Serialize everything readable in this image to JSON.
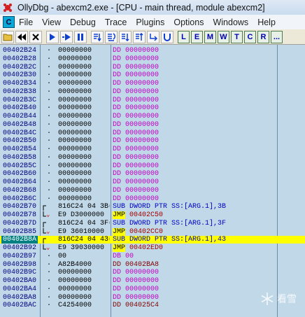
{
  "title": "OllyDbg - abexcm2.exe - [CPU - main thread, module abexcm2]",
  "menu": [
    "File",
    "View",
    "Debug",
    "Trace",
    "Plugins",
    "Options",
    "Windows",
    "Help"
  ],
  "menu_icon": "C",
  "toolbar_letters": [
    "L",
    "E",
    "M",
    "W",
    "T",
    "C",
    "R",
    "..."
  ],
  "watermark": "看雪",
  "rows": [
    {
      "addr": "00402B24",
      "dot": "·",
      "hex": "00000000",
      "mnem": "DD 00000000",
      "kind": "dd"
    },
    {
      "addr": "00402B28",
      "dot": "·",
      "hex": "00000000",
      "mnem": "DD 00000000",
      "kind": "dd"
    },
    {
      "addr": "00402B2C",
      "dot": "·",
      "hex": "00000000",
      "mnem": "DD 00000000",
      "kind": "dd"
    },
    {
      "addr": "00402B30",
      "dot": "·",
      "hex": "00000000",
      "mnem": "DD 00000000",
      "kind": "dd"
    },
    {
      "addr": "00402B34",
      "dot": "·",
      "hex": "00000000",
      "mnem": "DD 00000000",
      "kind": "dd"
    },
    {
      "addr": "00402B38",
      "dot": "·",
      "hex": "00000000",
      "mnem": "DD 00000000",
      "kind": "dd"
    },
    {
      "addr": "00402B3C",
      "dot": "·",
      "hex": "00000000",
      "mnem": "DD 00000000",
      "kind": "dd"
    },
    {
      "addr": "00402B40",
      "dot": "·",
      "hex": "00000000",
      "mnem": "DD 00000000",
      "kind": "dd"
    },
    {
      "addr": "00402B44",
      "dot": "·",
      "hex": "00000000",
      "mnem": "DD 00000000",
      "kind": "dd"
    },
    {
      "addr": "00402B48",
      "dot": "·",
      "hex": "00000000",
      "mnem": "DD 00000000",
      "kind": "dd"
    },
    {
      "addr": "00402B4C",
      "dot": "·",
      "hex": "00000000",
      "mnem": "DD 00000000",
      "kind": "dd"
    },
    {
      "addr": "00402B50",
      "dot": "·",
      "hex": "00000000",
      "mnem": "DD 00000000",
      "kind": "dd"
    },
    {
      "addr": "00402B54",
      "dot": "·",
      "hex": "00000000",
      "mnem": "DD 00000000",
      "kind": "dd"
    },
    {
      "addr": "00402B58",
      "dot": "·",
      "hex": "00000000",
      "mnem": "DD 00000000",
      "kind": "dd"
    },
    {
      "addr": "00402B5C",
      "dot": "·",
      "hex": "00000000",
      "mnem": "DD 00000000",
      "kind": "dd"
    },
    {
      "addr": "00402B60",
      "dot": "·",
      "hex": "00000000",
      "mnem": "DD 00000000",
      "kind": "dd"
    },
    {
      "addr": "00402B64",
      "dot": "·",
      "hex": "00000000",
      "mnem": "DD 00000000",
      "kind": "dd"
    },
    {
      "addr": "00402B68",
      "dot": "·",
      "hex": "00000000",
      "mnem": "DD 00000000",
      "kind": "dd"
    },
    {
      "addr": "00402B6C",
      "dot": "·",
      "hex": "00000000",
      "mnem": "DD 00000000",
      "kind": "dd"
    },
    {
      "addr": "00402B70",
      "dot": "",
      "hex": "816C24 04 3B(",
      "mnem": "SUB DWORD PTR SS:[ARG.1],3B",
      "kind": "sub",
      "mark": "top"
    },
    {
      "addr": "00402B78",
      "dot": "",
      "hex": "E9 D3000000",
      "mnem": "JMP 00402C50",
      "kind": "jmp",
      "mark": "bottom"
    },
    {
      "addr": "00402B7D",
      "dot": "",
      "hex": "816C24 04 3F(",
      "mnem": "SUB DWORD PTR SS:[ARG.1],3F",
      "kind": "sub",
      "mark": "top"
    },
    {
      "addr": "00402B85",
      "dot": "",
      "hex": "E9 36010000",
      "mnem": "JMP 00402CC0",
      "kind": "jmp",
      "mark": "bottom"
    },
    {
      "addr": "00402B8A",
      "dot": "",
      "hex": "816C24 04 43(",
      "mnem": "SUB DWORD PTR SS:[ARG.1],43",
      "kind": "sub",
      "mark": "top",
      "selected": true
    },
    {
      "addr": "00402B92",
      "dot": "",
      "hex": "E9 39030000",
      "mnem": "JMP 00402ED0",
      "kind": "jmp",
      "mark": "bottom"
    },
    {
      "addr": "00402B97",
      "dot": "·",
      "hex": "00",
      "mnem": "DB 00",
      "kind": "db"
    },
    {
      "addr": "00402B98",
      "dot": "·",
      "hex": "A82B4000",
      "mnem": "DD 00402BA8",
      "kind": "dd2"
    },
    {
      "addr": "00402B9C",
      "dot": "·",
      "hex": "00000000",
      "mnem": "DD 00000000",
      "kind": "dd"
    },
    {
      "addr": "00402BA0",
      "dot": "·",
      "hex": "00000000",
      "mnem": "DD 00000000",
      "kind": "dd"
    },
    {
      "addr": "00402BA4",
      "dot": "·",
      "hex": "00000000",
      "mnem": "DD 00000000",
      "kind": "dd"
    },
    {
      "addr": "00402BA8",
      "dot": "·",
      "hex": "00000000",
      "mnem": "DD 00000000",
      "kind": "dd"
    },
    {
      "addr": "00402BAC",
      "dot": "·",
      "hex": "C4254000",
      "mnem": "DD 004025C4",
      "kind": "dd2"
    }
  ]
}
